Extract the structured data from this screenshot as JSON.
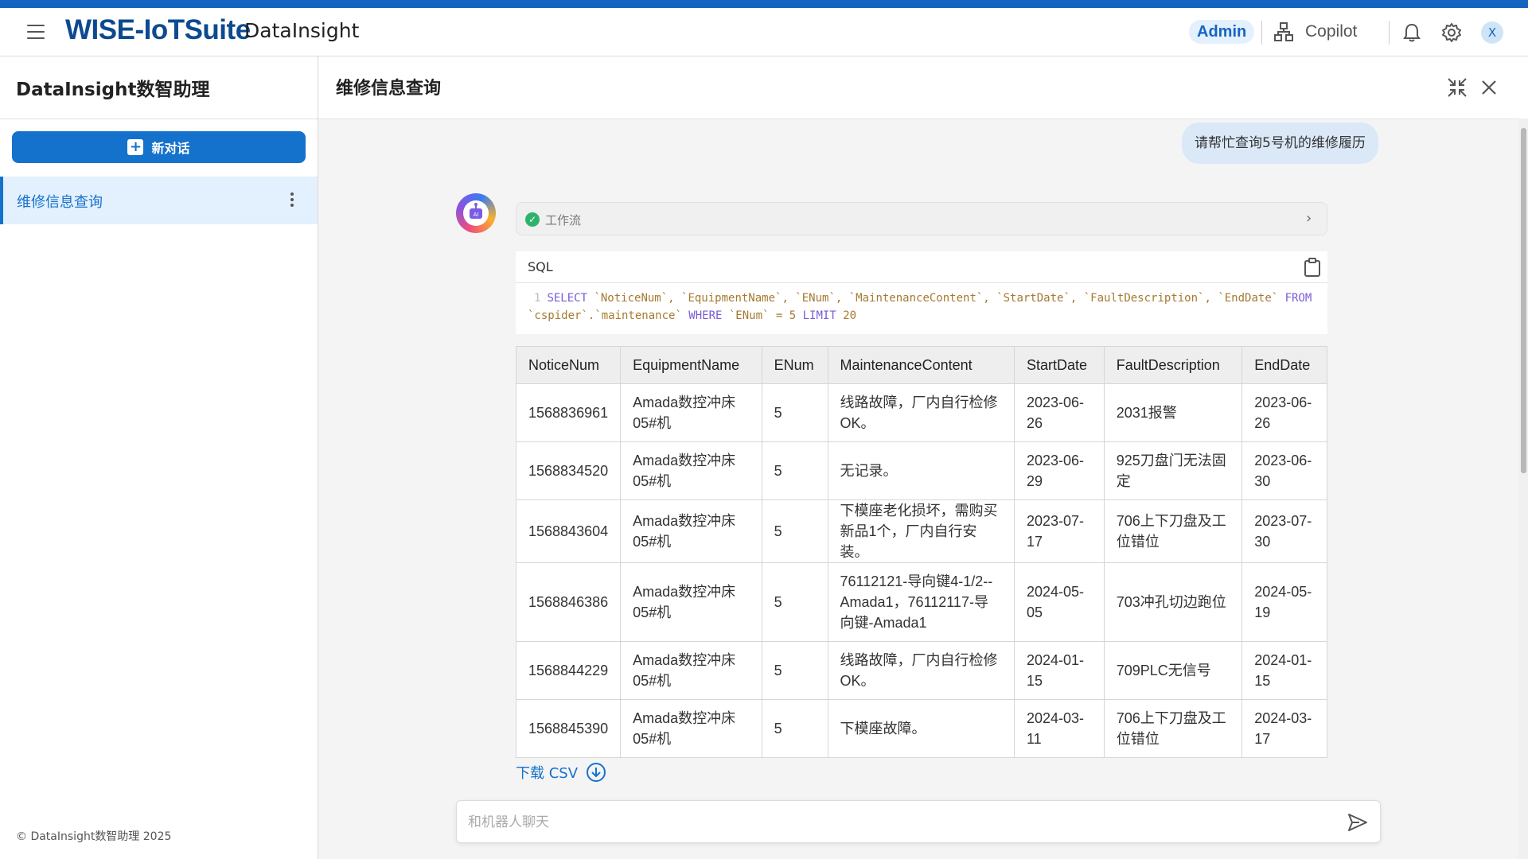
{
  "header": {
    "brand": "WISE-IoTSuite",
    "product": "DataInsight",
    "role_badge": "Admin",
    "copilot_label": "Copilot",
    "avatar_letter": "X"
  },
  "sidebar": {
    "title": "DataInsight数智助理",
    "new_chat_label": "新对话",
    "conversations": [
      {
        "label": "维修信息查询"
      }
    ],
    "footer": "© DataInsight数智助理 2025"
  },
  "main": {
    "title": "维修信息查询",
    "user_message": "请帮忙查询5号机的维修履历",
    "workflow_label": "工作流",
    "sql": {
      "label": "SQL",
      "line_number": "1",
      "kw_select": "SELECT",
      "columns_part": " `NoticeNum`, `EquipmentName`, `ENum`, `MaintenanceContent`, `StartDate`, `FaultDescription`, `EndDate` ",
      "kw_from": "FROM",
      "table_part": "`cspider`.`maintenance` ",
      "kw_where": "WHERE",
      "cond_part": " `ENum` = 5 ",
      "kw_limit": "LIMIT",
      "limit_value": " 20"
    },
    "table": {
      "columns": [
        "NoticeNum",
        "EquipmentName",
        "ENum",
        "MaintenanceContent",
        "StartDate",
        "FaultDescription",
        "EndDate"
      ],
      "rows": [
        [
          "1568836961",
          "Amada数控冲床05#机",
          "5",
          "线路故障，厂内自行检修OK。",
          "2023-06-26",
          "2031报警",
          "2023-06-26"
        ],
        [
          "1568834520",
          "Amada数控冲床05#机",
          "5",
          "无记录。",
          "2023-06-29",
          "925刀盘门无法固定",
          "2023-06-30"
        ],
        [
          "1568843604",
          "Amada数控冲床05#机",
          "5",
          "下模座老化损坏，需购买新品1个，厂内自行安装。",
          "2023-07-17",
          "706上下刀盘及工位错位",
          "2023-07-30"
        ],
        [
          "1568846386",
          "Amada数控冲床05#机",
          "5",
          "76112121-导向键4-1/2--Amada1，76112117-导向键-Amada1",
          "2024-05-05",
          "703冲孔切边跑位",
          "2024-05-19"
        ],
        [
          "1568844229",
          "Amada数控冲床05#机",
          "5",
          "线路故障，厂内自行检修OK。",
          "2024-01-15",
          "709PLC无信号",
          "2024-01-15"
        ],
        [
          "1568845390",
          "Amada数控冲床05#机",
          "5",
          "下模座故障。",
          "2024-03-11",
          "706上下刀盘及工位错位",
          "2024-03-17"
        ]
      ]
    },
    "download_csv_label": "下载 CSV",
    "chat_placeholder": "和机器人聊天"
  },
  "colors": {
    "brand_blue": "#0d4a8f",
    "accent": "#1572cc",
    "top_strip": "#1565c0",
    "success": "#2fb36a"
  },
  "icons": [
    "menu-icon",
    "sitemap-icon",
    "bell-icon",
    "gear-icon",
    "plus-icon",
    "kebab-icon",
    "collapse-icon",
    "close-icon",
    "check-circle-icon",
    "chevron-right-icon",
    "clipboard-icon",
    "download-icon",
    "send-icon",
    "ai-bot-icon"
  ]
}
